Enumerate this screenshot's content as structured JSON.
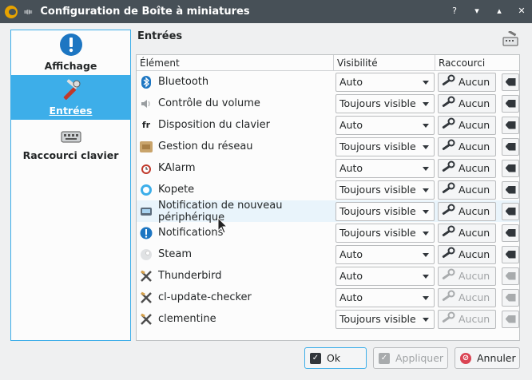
{
  "window": {
    "title": "Configuration de Boîte à miniatures"
  },
  "sidebar": {
    "items": [
      {
        "label": "Affichage",
        "icon": "info-icon",
        "active": false
      },
      {
        "label": "Entrées",
        "icon": "tools-icon",
        "active": true
      },
      {
        "label": "Raccourci clavier",
        "icon": "keyboard-icon",
        "active": false
      }
    ]
  },
  "main": {
    "section_title": "Entrées",
    "columns": [
      "Élément",
      "Visibilité",
      "Raccourci clavier"
    ],
    "rows": [
      {
        "name": "Bluetooth",
        "icon": "bluetooth-icon",
        "visibility": "Auto",
        "shortcut": "Aucun",
        "enabled": true
      },
      {
        "name": "Contrôle du volume",
        "icon": "volume-icon",
        "visibility": "Toujours visible",
        "shortcut": "Aucun",
        "enabled": true
      },
      {
        "name": "Disposition du clavier",
        "icon": "keyboard-layout-icon",
        "visibility": "Auto",
        "shortcut": "Aucun",
        "enabled": true
      },
      {
        "name": "Gestion du réseau",
        "icon": "network-icon",
        "visibility": "Toujours visible",
        "shortcut": "Aucun",
        "enabled": true
      },
      {
        "name": "KAlarm",
        "icon": "alarm-icon",
        "visibility": "Auto",
        "shortcut": "Aucun",
        "enabled": true
      },
      {
        "name": "Kopete",
        "icon": "kopete-icon",
        "visibility": "Toujours visible",
        "shortcut": "Aucun",
        "enabled": true
      },
      {
        "name": "Notification de nouveau périphérique",
        "icon": "device-icon",
        "visibility": "Toujours visible",
        "shortcut": "Aucun",
        "enabled": true
      },
      {
        "name": "Notifications",
        "icon": "notification-icon",
        "visibility": "Toujours visible",
        "shortcut": "Aucun",
        "enabled": true
      },
      {
        "name": "Steam",
        "icon": "steam-icon",
        "visibility": "Auto",
        "shortcut": "Aucun",
        "enabled": true
      },
      {
        "name": "Thunderbird",
        "icon": "generic-app-icon",
        "visibility": "Auto",
        "shortcut": "Aucun",
        "enabled": false
      },
      {
        "name": "cl-update-checker",
        "icon": "generic-app-icon",
        "visibility": "Auto",
        "shortcut": "Aucun",
        "enabled": false
      },
      {
        "name": "clementine",
        "icon": "generic-app-icon",
        "visibility": "Toujours visible",
        "shortcut": "Aucun",
        "enabled": false
      }
    ]
  },
  "footer": {
    "ok_label": "Ok",
    "apply_label": "Appliquer",
    "cancel_label": "Annuler"
  },
  "colors": {
    "accent": "#3daee9",
    "titlebar": "#475057",
    "error": "#da4453"
  }
}
